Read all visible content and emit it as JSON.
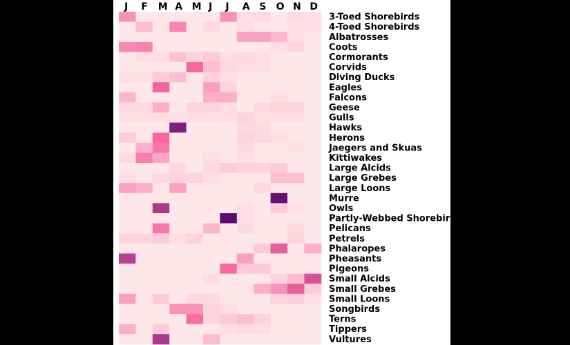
{
  "chart_data": {
    "type": "heatmap",
    "title": "",
    "months": [
      "J",
      "F",
      "M",
      "A",
      "M",
      "J",
      "J",
      "A",
      "S",
      "O",
      "N",
      "D"
    ],
    "value_range": [
      0,
      1
    ],
    "colors": {
      "background": "#000000",
      "panel": "#ffffff",
      "low": "#fff5f0",
      "mid": "#f768a1",
      "high": "#49006a"
    },
    "rows": [
      {
        "label": "3-Toed Shorebirds",
        "values": [
          0.35,
          0.05,
          0.05,
          0.05,
          0.05,
          0.05,
          0.35,
          0.08,
          0.1,
          0.05,
          0.1,
          0.08
        ]
      },
      {
        "label": "4-Toed Shorebirds",
        "values": [
          0.05,
          0.2,
          0.05,
          0.4,
          0.05,
          0.1,
          0.05,
          0.08,
          0.05,
          0.05,
          0.08,
          0.08
        ]
      },
      {
        "label": "Albatrosses",
        "values": [
          0.05,
          0.05,
          0.05,
          0.05,
          0.05,
          0.05,
          0.05,
          0.3,
          0.3,
          0.22,
          0.08,
          0.05
        ]
      },
      {
        "label": "Coots",
        "values": [
          0.38,
          0.4,
          0.05,
          0.05,
          0.05,
          0.05,
          0.05,
          0.05,
          0.05,
          0.08,
          0.12,
          0.05
        ]
      },
      {
        "label": "Cormorants",
        "values": [
          0.05,
          0.08,
          0.08,
          0.18,
          0.12,
          0.15,
          0.08,
          0.1,
          0.08,
          0.05,
          0.05,
          0.05
        ]
      },
      {
        "label": "Corvids",
        "values": [
          0.05,
          0.05,
          0.05,
          0.05,
          0.5,
          0.2,
          0.1,
          0.08,
          0.08,
          0.05,
          0.05,
          0.05
        ]
      },
      {
        "label": "Diving Ducks",
        "values": [
          0.08,
          0.08,
          0.15,
          0.2,
          0.05,
          0.12,
          0.08,
          0.05,
          0.05,
          0.05,
          0.05,
          0.05
        ]
      },
      {
        "label": "Eagles",
        "values": [
          0.05,
          0.05,
          0.52,
          0.05,
          0.05,
          0.3,
          0.12,
          0.05,
          0.05,
          0.05,
          0.05,
          0.05
        ]
      },
      {
        "label": "Falcons",
        "values": [
          0.22,
          0.05,
          0.05,
          0.05,
          0.05,
          0.25,
          0.25,
          0.05,
          0.05,
          0.08,
          0.05,
          0.05
        ]
      },
      {
        "label": "Geese",
        "values": [
          0.1,
          0.1,
          0.25,
          0.05,
          0.12,
          0.12,
          0.08,
          0.05,
          0.1,
          0.12,
          0.12,
          0.05
        ]
      },
      {
        "label": "Gulls",
        "values": [
          0.08,
          0.08,
          0.08,
          0.08,
          0.08,
          0.08,
          0.08,
          0.12,
          0.08,
          0.08,
          0.08,
          0.05
        ]
      },
      {
        "label": "Hawks",
        "values": [
          0.05,
          0.05,
          0.05,
          0.85,
          0.05,
          0.05,
          0.05,
          0.1,
          0.1,
          0.05,
          0.05,
          0.05
        ]
      },
      {
        "label": "Herons",
        "values": [
          0.15,
          0.05,
          0.5,
          0.05,
          0.05,
          0.05,
          0.05,
          0.12,
          0.1,
          0.08,
          0.05,
          0.05
        ]
      },
      {
        "label": "Jaegers and Skuas",
        "values": [
          0.05,
          0.25,
          0.45,
          0.05,
          0.05,
          0.05,
          0.05,
          0.1,
          0.05,
          0.05,
          0.08,
          0.05
        ]
      },
      {
        "label": "Kittiwakes",
        "values": [
          0.1,
          0.42,
          0.28,
          0.05,
          0.05,
          0.08,
          0.05,
          0.08,
          0.05,
          0.05,
          0.05,
          0.05
        ]
      },
      {
        "label": "Large Alcids",
        "values": [
          0.05,
          0.05,
          0.05,
          0.1,
          0.05,
          0.1,
          0.15,
          0.12,
          0.12,
          0.15,
          0.05,
          0.05
        ]
      },
      {
        "label": "Large Grebes",
        "values": [
          0.08,
          0.05,
          0.1,
          0.12,
          0.12,
          0.08,
          0.05,
          0.05,
          0.05,
          0.2,
          0.2,
          0.05
        ]
      },
      {
        "label": "Large Loons",
        "values": [
          0.3,
          0.25,
          0.05,
          0.3,
          0.05,
          0.05,
          0.05,
          0.05,
          0.1,
          0.05,
          0.05,
          0.05
        ]
      },
      {
        "label": "Murre",
        "values": [
          0.05,
          0.05,
          0.05,
          0.05,
          0.05,
          0.05,
          0.05,
          0.05,
          0.05,
          0.92,
          0.05,
          0.05
        ]
      },
      {
        "label": "Owls",
        "values": [
          0.05,
          0.05,
          0.72,
          0.05,
          0.05,
          0.05,
          0.05,
          0.08,
          0.05,
          0.15,
          0.08,
          0.05
        ]
      },
      {
        "label": "Partly-Webbed Shorebirds",
        "values": [
          0.05,
          0.05,
          0.05,
          0.05,
          0.05,
          0.05,
          0.95,
          0.08,
          0.05,
          0.05,
          0.05,
          0.05
        ]
      },
      {
        "label": "Pelicans",
        "values": [
          0.05,
          0.05,
          0.45,
          0.05,
          0.05,
          0.22,
          0.05,
          0.1,
          0.05,
          0.05,
          0.1,
          0.05
        ]
      },
      {
        "label": "Petrels",
        "values": [
          0.12,
          0.12,
          0.15,
          0.08,
          0.12,
          0.05,
          0.05,
          0.05,
          0.05,
          0.05,
          0.12,
          0.05
        ]
      },
      {
        "label": "Phalaropes",
        "values": [
          0.05,
          0.05,
          0.05,
          0.05,
          0.05,
          0.05,
          0.05,
          0.05,
          0.15,
          0.55,
          0.05,
          0.25
        ]
      },
      {
        "label": "Pheasants",
        "values": [
          0.68,
          0.05,
          0.05,
          0.05,
          0.05,
          0.05,
          0.05,
          0.3,
          0.05,
          0.05,
          0.05,
          0.05
        ]
      },
      {
        "label": "Pigeons",
        "values": [
          0.05,
          0.05,
          0.05,
          0.05,
          0.05,
          0.05,
          0.5,
          0.15,
          0.15,
          0.05,
          0.05,
          0.05
        ]
      },
      {
        "label": "Small Alcids",
        "values": [
          0.05,
          0.05,
          0.05,
          0.05,
          0.05,
          0.08,
          0.05,
          0.05,
          0.05,
          0.12,
          0.2,
          0.6
        ]
      },
      {
        "label": "Small Grebes",
        "values": [
          0.05,
          0.05,
          0.05,
          0.05,
          0.05,
          0.05,
          0.05,
          0.05,
          0.25,
          0.35,
          0.55,
          0.15
        ]
      },
      {
        "label": "Small Loons",
        "values": [
          0.3,
          0.05,
          0.15,
          0.05,
          0.1,
          0.1,
          0.05,
          0.05,
          0.05,
          0.12,
          0.15,
          0.08
        ]
      },
      {
        "label": "Songbirds",
        "values": [
          0.05,
          0.05,
          0.05,
          0.35,
          0.35,
          0.12,
          0.08,
          0.05,
          0.05,
          0.05,
          0.05,
          0.05
        ]
      },
      {
        "label": "Terns",
        "values": [
          0.05,
          0.05,
          0.05,
          0.05,
          0.48,
          0.12,
          0.15,
          0.2,
          0.12,
          0.05,
          0.05,
          0.05
        ]
      },
      {
        "label": "Tippers",
        "values": [
          0.25,
          0.05,
          0.15,
          0.05,
          0.05,
          0.05,
          0.08,
          0.1,
          0.08,
          0.05,
          0.05,
          0.05
        ]
      },
      {
        "label": "Vultures",
        "values": [
          0.05,
          0.05,
          0.72,
          0.05,
          0.05,
          0.2,
          0.05,
          0.05,
          0.05,
          0.05,
          0.05,
          0.05
        ]
      }
    ]
  }
}
